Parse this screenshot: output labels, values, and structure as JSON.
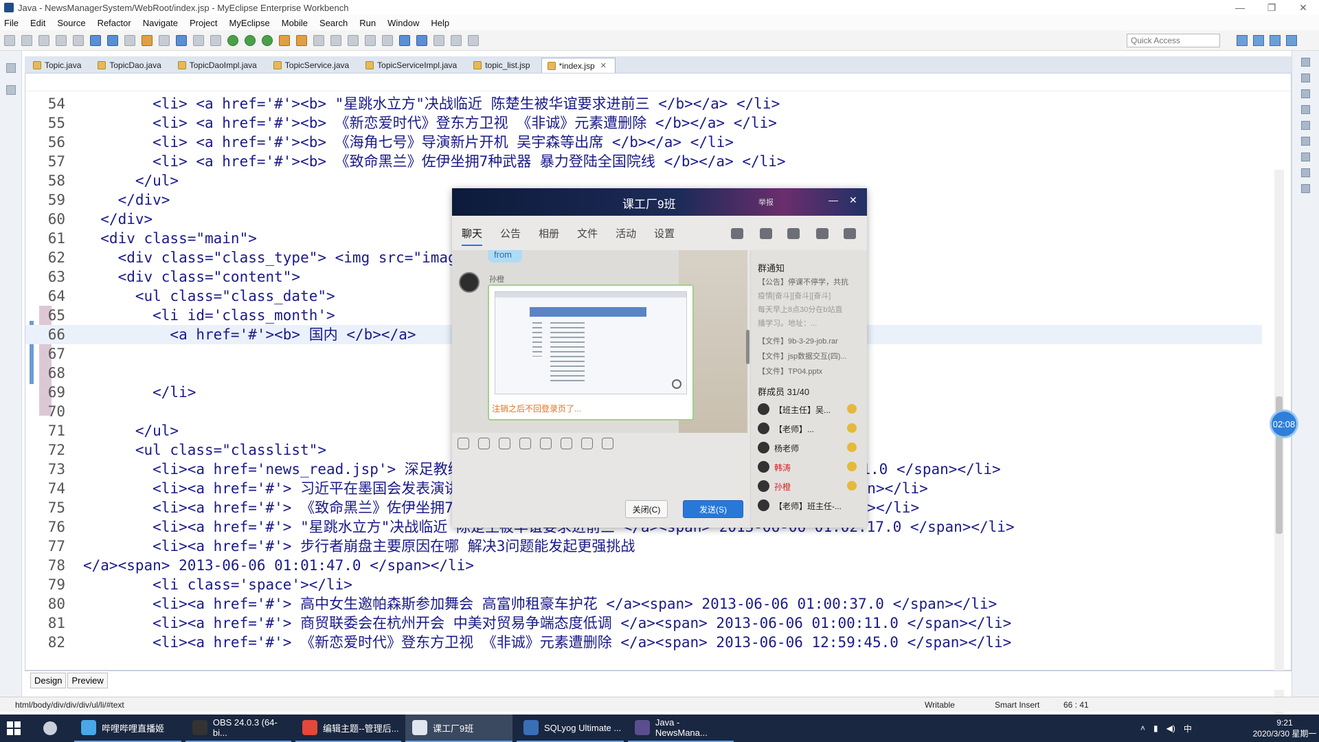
{
  "window": {
    "title": "Java - NewsManagerSystem/WebRoot/index.jsp - MyEclipse Enterprise Workbench",
    "controls": [
      "—",
      "❐",
      "✕"
    ]
  },
  "menu": [
    "File",
    "Edit",
    "Source",
    "Refactor",
    "Navigate",
    "Project",
    "MyEclipse",
    "Mobile",
    "Search",
    "Run",
    "Window",
    "Help"
  ],
  "toolbar": {
    "quick_access_placeholder": "Quick Access"
  },
  "tabs": [
    {
      "label": "Topic.java",
      "active": false
    },
    {
      "label": "TopicDao.java",
      "active": false
    },
    {
      "label": "TopicDaoImpl.java",
      "active": false
    },
    {
      "label": "TopicService.java",
      "active": false
    },
    {
      "label": "TopicServiceImpl.java",
      "active": false
    },
    {
      "label": "topic_list.jsp",
      "active": false
    },
    {
      "label": "*index.jsp",
      "active": true
    }
  ],
  "code": [
    {
      "n": "54",
      "t": "        <li> <a href='#'><b> \"星跳水立方\"决战临近 陈楚生被华谊要求进前三 </b></a> </li>"
    },
    {
      "n": "55",
      "t": "        <li> <a href='#'><b> 《新恋爱时代》登东方卫视 《非诚》元素遭删除 </b></a> </li>"
    },
    {
      "n": "56",
      "t": "        <li> <a href='#'><b> 《海角七号》导演新片开机 吴宇森等出席 </b></a> </li>"
    },
    {
      "n": "57",
      "t": "        <li> <a href='#'><b> 《致命黑兰》佐伊坐拥7种武器 暴力登陆全国院线 </b></a> </li>"
    },
    {
      "n": "58",
      "t": "      </ul>"
    },
    {
      "n": "59",
      "t": "    </div>"
    },
    {
      "n": "60",
      "t": "  </div>"
    },
    {
      "n": "61",
      "t": "  <div class=\"main\">"
    },
    {
      "n": "62",
      "t": "    <div class=\"class_type\"> <img src=\"imag"
    },
    {
      "n": "63",
      "t": "    <div class=\"content\">"
    },
    {
      "n": "64",
      "t": "      <ul class=\"class_date\">"
    },
    {
      "n": "65",
      "t": "        <li id='class_month'>"
    },
    {
      "n": "66",
      "t": "          <a href='#'><b> 国内 </b></a>"
    },
    {
      "n": "67",
      "t": ""
    },
    {
      "n": "68",
      "t": ""
    },
    {
      "n": "69",
      "t": "        </li>"
    },
    {
      "n": "70",
      "t": ""
    },
    {
      "n": "71",
      "t": "      </ul>"
    },
    {
      "n": "72",
      "t": "      <ul class=\"classlist\">"
    },
    {
      "n": "73",
      "t": "        <li><a href='news_read.jsp'> 深足教练                                    06 01:03:51.0 </span></li>"
    },
    {
      "n": "74",
      "t": "        <li><a href='#'> 习近平在墨国会发表演讲:                                         </span></li>"
    },
    {
      "n": "75",
      "t": "        <li><a href='#'> 《致命黑兰》佐伊坐拥7种                                      0 </span></li>"
    },
    {
      "n": "76",
      "t": "        <li><a href='#'> \"星跳水立方\"决战临近 陈楚生被华谊要求进前三 </a><span> 2013-06-06 01:02:17.0 </span></li>"
    },
    {
      "n": "77",
      "t": "        <li><a href='#'> 步行者崩盘主要原因在哪 解决3问题能发起更强挑战"
    },
    {
      "n": "78",
      "t": "</a><span> 2013-06-06 01:01:47.0 </span></li>"
    },
    {
      "n": "79",
      "t": "        <li class='space'></li>"
    },
    {
      "n": "80",
      "t": "        <li><a href='#'> 高中女生邀帕森斯参加舞会 高富帅租豪车护花 </a><span> 2013-06-06 01:00:37.0 </span></li>"
    },
    {
      "n": "81",
      "t": "        <li><a href='#'> 商贸联委会在杭州开会 中美对贸易争端态度低调 </a><span> 2013-06-06 01:00:11.0 </span></li>"
    },
    {
      "n": "82",
      "t": "        <li><a href='#'> 《新恋爱时代》登东方卫视 《非诚》元素遭删除 </a><span> 2013-06-06 12:59:45.0 </span></li>"
    }
  ],
  "editor_bottom_tabs": [
    "Design",
    "Preview"
  ],
  "status": {
    "path": "html/body/div/div/div/ul/li/#text",
    "mode": "Writable",
    "insert": "Smart Insert",
    "position": "66 : 41"
  },
  "timer": "02:08",
  "qq": {
    "title": "课工厂9班",
    "report": "举报",
    "nav": [
      "聊天",
      "公告",
      "相册",
      "文件",
      "活动",
      "设置"
    ],
    "from_label": "from",
    "sender": "孙橙",
    "image_caption": "注销之后不回登录页了...",
    "notice_heading": "群通知",
    "notices": [
      "【公告】停课不停学，共抗",
      "疫情[奋斗][奋斗][奋斗]",
      "每天早上8点30分在b站直",
      "播学习。地址：..."
    ],
    "files": [
      "【文件】9b-3-29-job.rar",
      "【文件】jsp数据交互(四)...",
      "【文件】TP04.pptx"
    ],
    "members_label": "群成员 31/40",
    "members": [
      {
        "name": "【班主任】吴...",
        "red": false
      },
      {
        "name": "【老师】...",
        "red": false
      },
      {
        "name": "杨老师",
        "red": false
      },
      {
        "name": "韩涛",
        "red": true
      },
      {
        "name": "孙橙",
        "red": true
      },
      {
        "name": "【老师】班主任-...",
        "red": false
      }
    ],
    "close_button": "关闭(C)",
    "send_button": "发送(S)"
  },
  "taskbar": {
    "apps": [
      {
        "label": "哔哩哔哩直播姬",
        "color": "#4aa7e8"
      },
      {
        "label": "OBS 24.0.3 (64-bi...",
        "color": "#333333"
      },
      {
        "label": "编辑主题--管理后...",
        "color": "#e4473b"
      },
      {
        "label": "课工厂9班",
        "color": "#dfe6ef"
      },
      {
        "label": "SQLyog Ultimate ...",
        "color": "#3a6fb8"
      },
      {
        "label": "Java - NewsMana...",
        "color": "#5b4e8e"
      }
    ],
    "ime": "中",
    "time": "9:21",
    "date": "2020/3/30 星期一"
  }
}
